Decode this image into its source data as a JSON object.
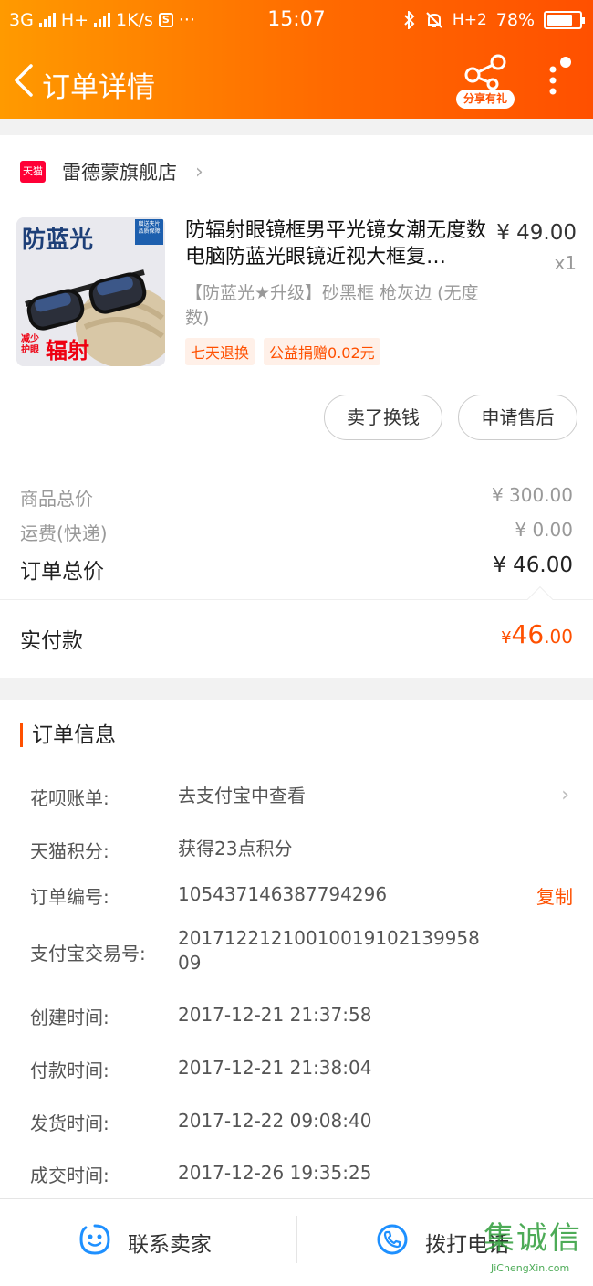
{
  "status_bar": {
    "network": "3G",
    "network2": "H+",
    "speed": "1K/s",
    "sim_icon": "S",
    "more": "···",
    "time": "15:07",
    "network3": "H+2",
    "battery": "78%",
    "battery_level": 0.78
  },
  "nav": {
    "title": "订单详情",
    "share_label": "分享有礼"
  },
  "store": {
    "badge": "天猫",
    "name": "雷德蒙旗舰店"
  },
  "product": {
    "image_text_top": "防蓝光",
    "image_badge": "赠送夹片 品质保障",
    "image_text_small": "减少 护眼",
    "image_text_big": "辐射",
    "title": "防辐射眼镜框男平光镜女潮无度数电脑防蓝光眼镜近视大框复…",
    "price": "¥ 49.00",
    "qty": "x1",
    "sku": "【防蓝光★升级】砂黑框 枪灰边 (无度数)",
    "tags": [
      "七天退换",
      "公益捐赠0.02元"
    ]
  },
  "actions": {
    "sell": "卖了换钱",
    "after_sale": "申请售后"
  },
  "costs": {
    "goods_total_label": "商品总价",
    "goods_total": "¥ 300.00",
    "shipping_label": "运费(快递)",
    "shipping": "¥ 0.00",
    "order_total_label": "订单总价",
    "order_total": "¥ 46.00",
    "paid_label": "实付款",
    "paid_currency": "¥",
    "paid_int": "46",
    "paid_dec": ".00"
  },
  "order_info": {
    "title": "订单信息",
    "rows": [
      {
        "key": "花呗账单:",
        "value": "去支付宝中查看"
      },
      {
        "key": "天猫积分:",
        "value": "获得23点积分"
      },
      {
        "key": "订单编号:",
        "value": "105437146387794296",
        "action": "复制"
      },
      {
        "key": "支付宝交易号:",
        "value": "2017122121001001910213995809"
      },
      {
        "key": "创建时间:",
        "value": "2017-12-21 21:37:58"
      },
      {
        "key": "付款时间:",
        "value": "2017-12-21 21:38:04"
      },
      {
        "key": "发货时间:",
        "value": "2017-12-22 09:08:40"
      },
      {
        "key": "成交时间:",
        "value": "2017-12-26 19:35:25"
      }
    ]
  },
  "bottom": {
    "contact_seller": "联系卖家",
    "call": "拨打电话"
  },
  "watermark": {
    "big": "集诚信",
    "small": "JiChengXin.com"
  },
  "colors": {
    "accent": "#ff5000",
    "header_start": "#ff9a00",
    "tmall": "#ff0036",
    "icon_blue": "#1e90ff"
  }
}
